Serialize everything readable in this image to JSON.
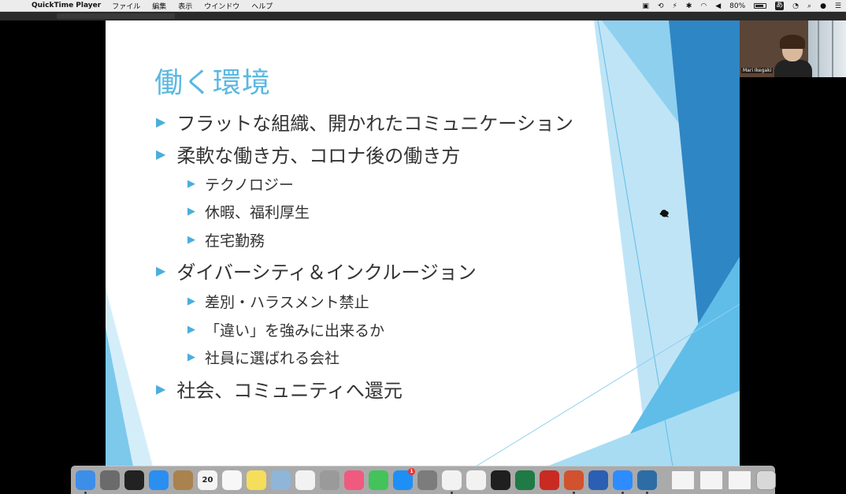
{
  "menubar": {
    "app_name": "QuickTime Player",
    "menus": [
      "ファイル",
      "編集",
      "表示",
      "ウインドウ",
      "ヘルプ"
    ],
    "battery": "80%",
    "input_method": "あ"
  },
  "slide": {
    "title": "働く環境",
    "bullets": [
      {
        "level": 1,
        "text": "フラットな組織、開かれたコミュニケーション"
      },
      {
        "level": 1,
        "text": "柔軟な働き方、コロナ後の働き方"
      },
      {
        "level": 2,
        "text": "テクノロジー"
      },
      {
        "level": 2,
        "text": "休暇、福利厚生"
      },
      {
        "level": 2,
        "text": "在宅勤務"
      },
      {
        "level": 1,
        "text": "ダイバーシティ＆インクルージョン"
      },
      {
        "level": 2,
        "text": "差別・ハラスメント禁止"
      },
      {
        "level": 2,
        "text": "「違い」を強みに出来るか"
      },
      {
        "level": 2,
        "text": "社員に選ばれる会社"
      },
      {
        "level": 1,
        "text": "社会、コミュニティへ還元"
      }
    ],
    "bullet_glyph": "▶",
    "accent_color": "#5ab8e0"
  },
  "video": {
    "participant_name": "Mari Ikegaki"
  },
  "dock": {
    "calendar_date": "20",
    "app_store_badge": "1",
    "apps": [
      {
        "name": "finder-icon",
        "color": "#3d8ee8",
        "running": true
      },
      {
        "name": "launchpad-icon",
        "color": "#6b6b6b",
        "running": false
      },
      {
        "name": "mission-control-icon",
        "color": "#222222",
        "running": false
      },
      {
        "name": "safari-icon",
        "color": "#2a8ff0",
        "running": false
      },
      {
        "name": "contacts-icon",
        "color": "#a9824e",
        "running": false
      },
      {
        "name": "calendar-icon",
        "color": "#f4f4f4",
        "running": false
      },
      {
        "name": "reminders-icon",
        "color": "#f7f7f7",
        "running": false
      },
      {
        "name": "notes-icon",
        "color": "#f6de5a",
        "running": false
      },
      {
        "name": "preview-icon",
        "color": "#8fb5d8",
        "running": false
      },
      {
        "name": "photos-icon",
        "color": "#f2f2f2",
        "running": false
      },
      {
        "name": "screenshot-icon",
        "color": "#9a9a9a",
        "running": false
      },
      {
        "name": "music-icon",
        "color": "#f05a7e",
        "running": false
      },
      {
        "name": "facetime-icon",
        "color": "#43c35a",
        "running": false
      },
      {
        "name": "app-store-icon",
        "color": "#1e90f5",
        "running": false
      },
      {
        "name": "system-preferences-icon",
        "color": "#7c7c7c",
        "running": false
      },
      {
        "name": "chrome-icon",
        "color": "#f2f2f2",
        "running": true
      },
      {
        "name": "textedit-icon",
        "color": "#f2f2f2",
        "running": false
      },
      {
        "name": "terminal-icon",
        "color": "#1f1f1f",
        "running": false
      },
      {
        "name": "excel-icon",
        "color": "#1f7a45",
        "running": false
      },
      {
        "name": "acrobat-icon",
        "color": "#c92a22",
        "running": false
      },
      {
        "name": "powerpoint-icon",
        "color": "#d2512f",
        "running": true
      },
      {
        "name": "word-icon",
        "color": "#2b5fb3",
        "running": false
      },
      {
        "name": "zoom-icon",
        "color": "#2d8cff",
        "running": true
      },
      {
        "name": "quicktime-icon",
        "color": "#2c6da6",
        "running": true
      }
    ],
    "trash_label": ""
  }
}
